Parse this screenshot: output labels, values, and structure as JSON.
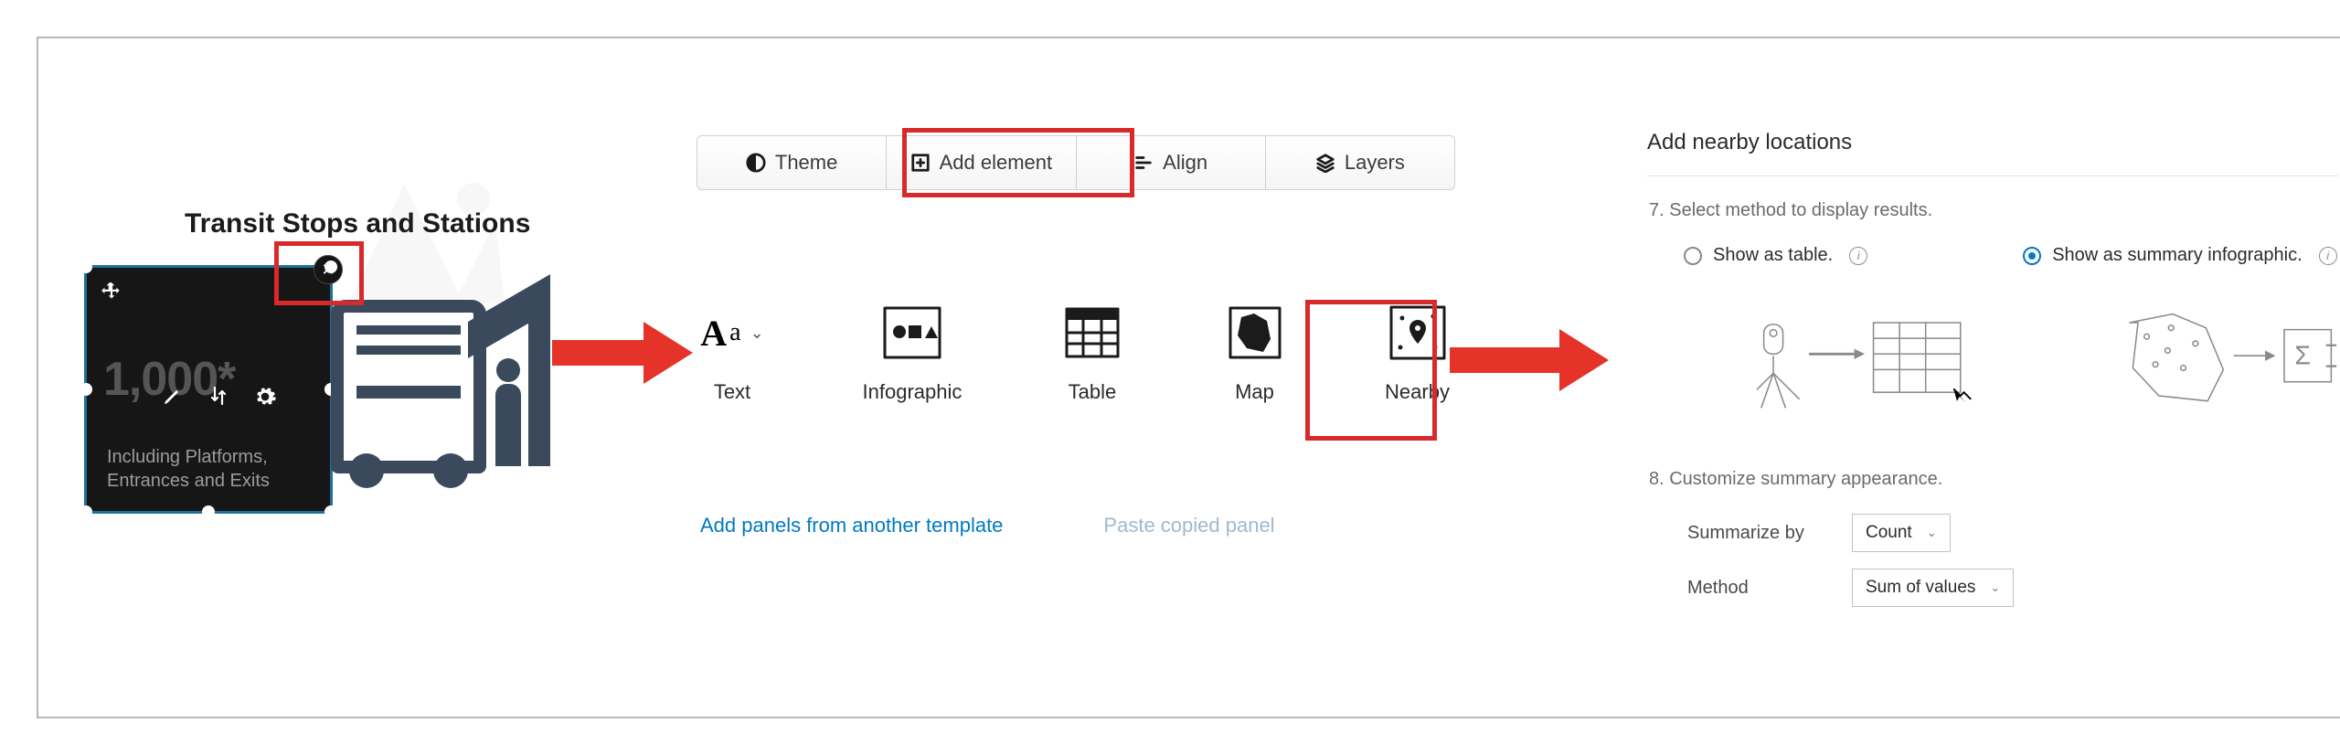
{
  "card": {
    "title": "Transit Stops and Stations",
    "big_number": "1,000*",
    "sub_line1": "Including Platforms,",
    "sub_line2": "Entrances and Exits"
  },
  "toolbar": {
    "theme": "Theme",
    "add_element": "Add element",
    "align": "Align",
    "layers": "Layers"
  },
  "gallery": {
    "text": "Text",
    "infographic": "Infographic",
    "table": "Table",
    "map": "Map",
    "nearby": "Nearby"
  },
  "mid_links": {
    "add_panels": "Add panels from another template",
    "paste_panel": "Paste copied panel"
  },
  "right": {
    "title": "Add nearby locations",
    "step7": "7.  Select method to display results.",
    "show_table": "Show as table.",
    "show_summary": "Show as summary infographic.",
    "step8": "8.  Customize summary appearance.",
    "summarize_by_label": "Summarize by",
    "summarize_by_value": "Count",
    "method_label": "Method",
    "method_value": "Sum of values"
  }
}
